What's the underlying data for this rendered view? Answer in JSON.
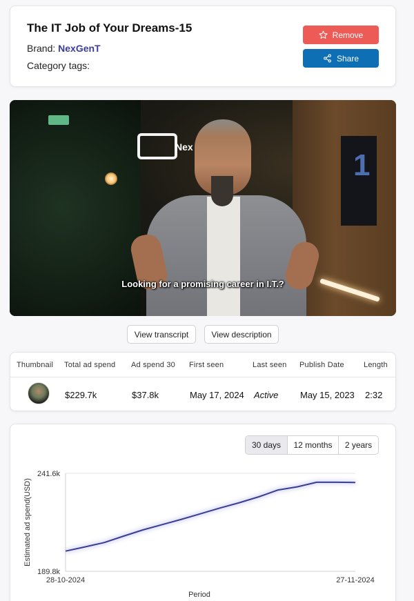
{
  "header": {
    "title": "The IT Job of Your Dreams-15",
    "brand_label": "Brand:",
    "brand_name": "NexGenT",
    "category_label": "Category tags:",
    "remove_label": "Remove",
    "share_label": "Share"
  },
  "video": {
    "subtitle": "Looking for a promising career in I.T.?",
    "logo_text": "Nex",
    "panel_number": "1"
  },
  "actions": {
    "transcript_label": "View transcript",
    "description_label": "View description"
  },
  "stats": {
    "headers": [
      "Thumbnail",
      "Total ad spend",
      "Ad spend 30",
      "First seen",
      "Last seen",
      "Publish Date",
      "Length"
    ],
    "row": {
      "total_ad_spend": "$229.7k",
      "ad_spend_30": "$37.8k",
      "first_seen": "May 17, 2024",
      "last_seen": "Active",
      "publish_date": "May 15, 2023",
      "length": "2:32"
    }
  },
  "range_tabs": {
    "options": [
      "30 days",
      "12 months",
      "2 years"
    ],
    "selected": "30 days"
  },
  "colors": {
    "remove": "#ec5b56",
    "share": "#0f6fb5",
    "brand": "#3b3d9e",
    "line": "#3b3d8f"
  },
  "chart_data": {
    "type": "line",
    "title": "",
    "xlabel": "Period",
    "ylabel": "Estimated ad spend(USD)",
    "x_ticks": [
      "28-10-2024",
      "27-11-2024"
    ],
    "y_ticks": [
      "189.8k",
      "241.6k"
    ],
    "ylim": [
      189.8,
      241.6
    ],
    "x": [
      "28-10-2024",
      "30-10-2024",
      "01-11-2024",
      "03-11-2024",
      "05-11-2024",
      "07-11-2024",
      "09-11-2024",
      "11-11-2024",
      "13-11-2024",
      "15-11-2024",
      "17-11-2024",
      "19-11-2024",
      "21-11-2024",
      "23-11-2024",
      "25-11-2024",
      "27-11-2024"
    ],
    "series": [
      {
        "values": [
          200.5,
          202.7,
          205.0,
          208.4,
          211.7,
          214.5,
          217.3,
          220.3,
          223.3,
          226.1,
          229.2,
          232.8,
          234.5,
          236.9,
          236.9,
          236.8
        ]
      }
    ],
    "grid": true,
    "legend": "none"
  }
}
